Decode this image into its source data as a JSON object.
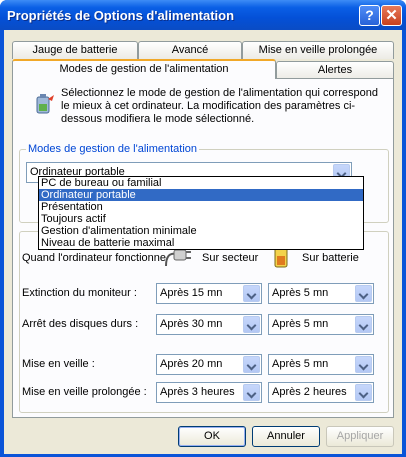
{
  "window": {
    "title": "Propriétés de Options d'alimentation",
    "help_label": "?",
    "close_label": "✕"
  },
  "tabs": [
    {
      "label": "Jauge de batterie"
    },
    {
      "label": "Avancé"
    },
    {
      "label": "Mise en veille prolongée"
    },
    {
      "label": "Modes de gestion de l'alimentation"
    },
    {
      "label": "Alertes"
    }
  ],
  "description": "Sélectionnez le mode de gestion de l'alimentation qui correspond le mieux à cet ordinateur. La modification des paramètres ci-dessous modifiera le mode sélectionné.",
  "schemes": {
    "group_label": "Modes de gestion de l'alimentation",
    "selected": "Ordinateur portable",
    "options": [
      "PC de bureau ou familial",
      "Ordinateur portable",
      "Présentation",
      "Toujours actif",
      "Gestion d'alimentation minimale",
      "Niveau de batterie maximal"
    ],
    "highlighted_index": 1
  },
  "settings": {
    "header_label": "Quand l'ordinateur fonctionne",
    "ac_label": "Sur secteur",
    "battery_label": "Sur batterie",
    "rows": [
      {
        "label": "Extinction du moniteur :",
        "ac": "Après 15 mn",
        "dc": "Après 5 mn"
      },
      {
        "label": "Arrêt des disques durs :",
        "ac": "Après 30 mn",
        "dc": "Après 5 mn"
      },
      {
        "label": "Mise en veille :",
        "ac": "Après 20 mn",
        "dc": "Après 5 mn"
      },
      {
        "label": "Mise en veille prolongée :",
        "ac": "Après 3 heures",
        "dc": "Après 2 heures"
      }
    ]
  },
  "buttons": {
    "ok": "OK",
    "cancel": "Annuler",
    "apply": "Appliquer"
  }
}
